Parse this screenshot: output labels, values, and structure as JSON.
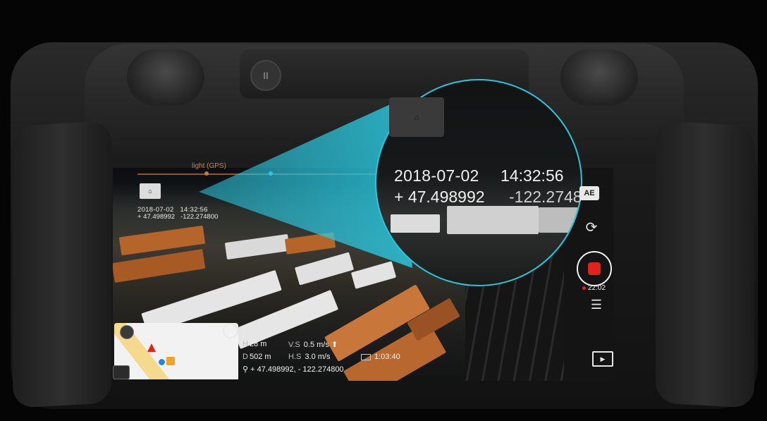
{
  "status_bar": {
    "flight_mode": "light (GPS)"
  },
  "overlay": {
    "date": "2018-07-02",
    "time": "14:32:56",
    "lat": "+ 47.498992",
    "lon_small": "-122.2748",
    "lon_magnified": "-122.2748"
  },
  "overlay_small": {
    "date": "2018-07-02",
    "time": "14:32:56",
    "lat": "+ 47.498992",
    "lon": "-122.274800"
  },
  "controls": {
    "ae_label": "AE",
    "record_time": "22:02"
  },
  "telemetry": {
    "h_label": "H",
    "h_value": "28 m",
    "d_label": "D",
    "d_value": "502 m",
    "vs_label": "V.S",
    "vs_value": "0.5 m/s",
    "hs_label": "H.S",
    "hs_value": "3.0 m/s",
    "battery_time": "1:03:40",
    "coordinates": "+ 47.498992, - 122.274800"
  },
  "colors": {
    "accent_cyan": "#2bc6de",
    "record_red": "#e0241c",
    "status_orange": "#c3783a"
  },
  "icons": {
    "return_home": "home-point-icon",
    "camera_switch": "camera-switch-icon",
    "settings": "settings-sliders-icon",
    "playback": "playback-icon",
    "compass": "compass-icon",
    "locate": "locate-icon"
  }
}
